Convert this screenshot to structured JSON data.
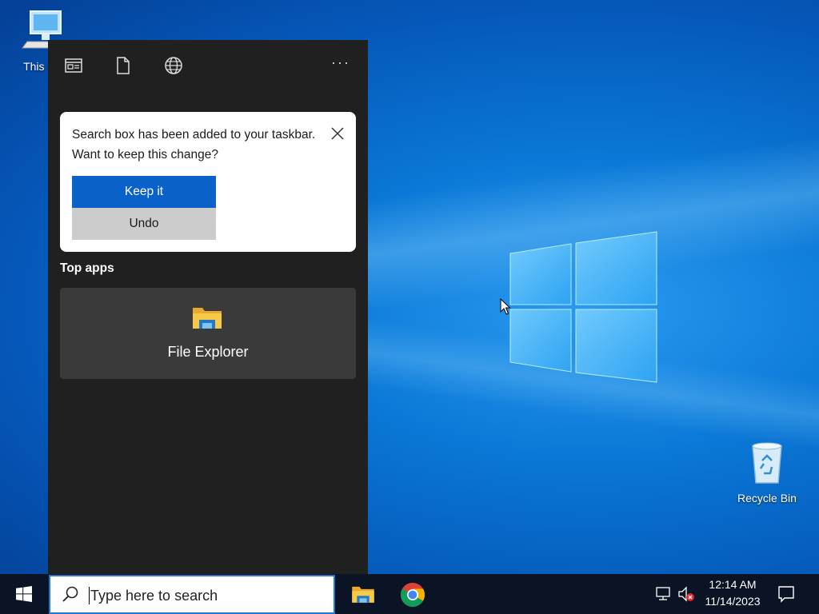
{
  "desktop": {
    "icons": [
      {
        "name": "this-pc",
        "label": "This PC"
      },
      {
        "name": "recycle-bin",
        "label": "Recycle Bin"
      }
    ]
  },
  "flyout": {
    "toolbar": [
      {
        "name": "apps-tab",
        "icon": "app-window-icon"
      },
      {
        "name": "documents-tab",
        "icon": "document-icon"
      },
      {
        "name": "web-tab",
        "icon": "globe-icon"
      }
    ],
    "more_label": "···",
    "notice": {
      "message": "Search box has been added to your taskbar. Want to keep this change?",
      "keep_label": "Keep it",
      "undo_label": "Undo"
    },
    "top_apps_title": "Top apps",
    "top_apps": [
      {
        "name": "File Explorer",
        "icon": "folder-icon"
      }
    ]
  },
  "taskbar": {
    "search_placeholder": "Type here to search",
    "pinned": [
      {
        "name": "file-explorer",
        "icon": "folder-icon"
      },
      {
        "name": "chrome",
        "icon": "chrome-icon"
      }
    ],
    "clock": {
      "time": "12:14 AM",
      "date": "11/14/2023"
    }
  },
  "colors": {
    "accent": "#0a62c9",
    "flyout_bg": "#202020",
    "tile_bg": "#3a3a3a",
    "taskbar_bg": "#0a1424"
  }
}
